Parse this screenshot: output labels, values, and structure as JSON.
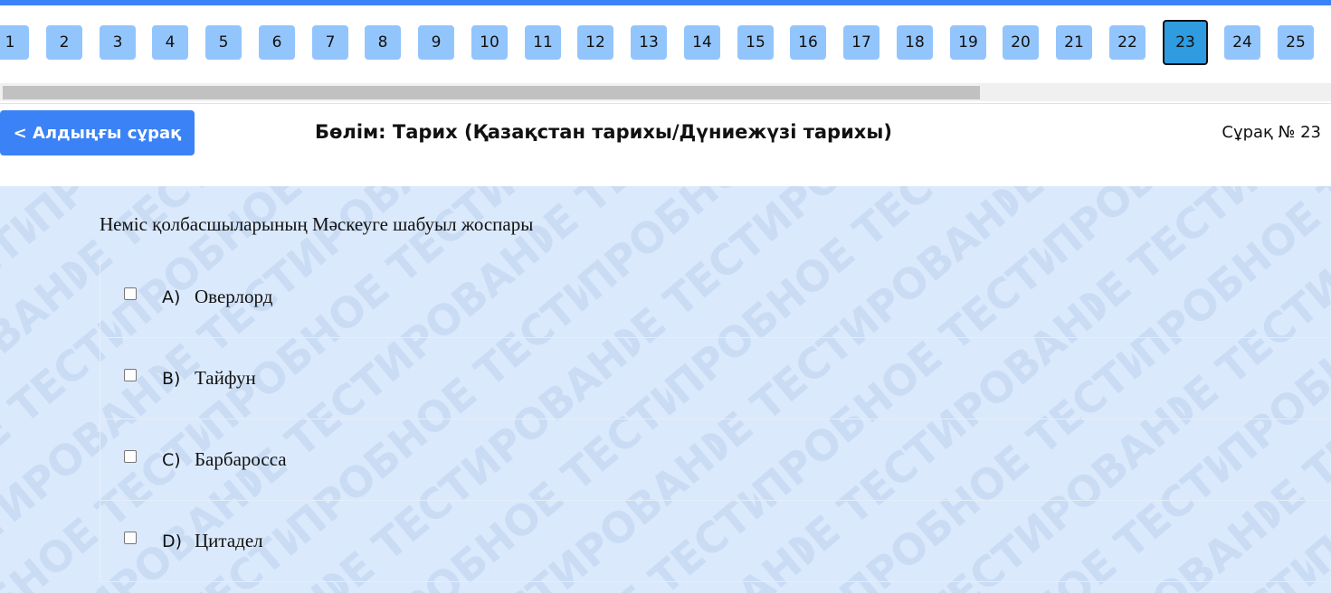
{
  "nav": {
    "numbers": [
      "1",
      "2",
      "3",
      "4",
      "5",
      "6",
      "7",
      "8",
      "9",
      "10",
      "11",
      "12",
      "13",
      "14",
      "15",
      "16",
      "17",
      "18",
      "19",
      "20",
      "21",
      "22",
      "23",
      "24",
      "25"
    ],
    "active": "23"
  },
  "header": {
    "prev_label": "< Алдыңғы сұрақ",
    "section": "Бөлім: Тарих (Қазақстан тарихы/Дүниежүзі тарихы)",
    "question_no": "Сұрақ № 23"
  },
  "watermark_text": "ПРОБНОЕ ТЕСТИРОВАНИЕ",
  "question": {
    "text": "Неміс қолбасшыларының Мәскеуге шабуыл жоспары",
    "options": [
      {
        "letter": "A)",
        "text": "Оверлорд"
      },
      {
        "letter": "B)",
        "text": "Тайфун"
      },
      {
        "letter": "C)",
        "text": "Барбаросса"
      },
      {
        "letter": "D)",
        "text": "Цитадел"
      }
    ]
  },
  "colors": {
    "accent": "#3b82f6",
    "nav_button": "#93c5fd",
    "nav_active": "#2f9be0",
    "content_bg": "#dbe9fc"
  }
}
